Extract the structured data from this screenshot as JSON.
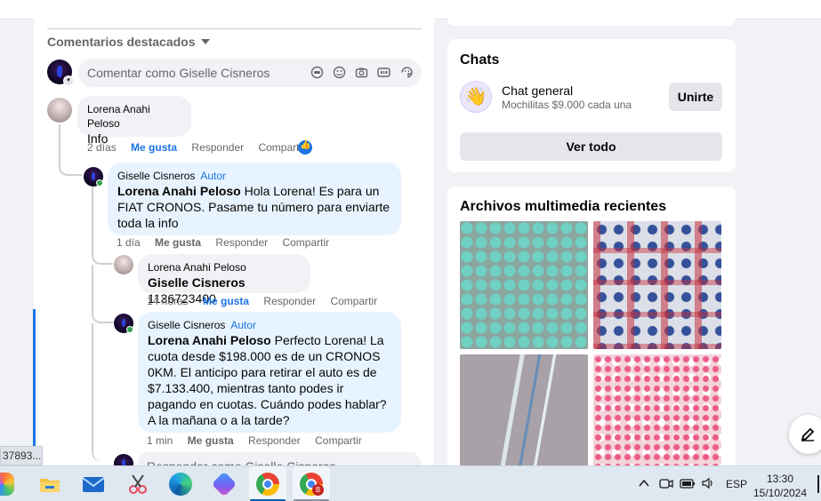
{
  "featured": {
    "label": "Comentarios destacados"
  },
  "composer": {
    "placeholder": "Comentar como Giselle Cisneros"
  },
  "comments": [
    {
      "author": "Lorena Anahi Peloso",
      "text": "Info",
      "time": "2 días",
      "like": "Me gusta",
      "reply": "Responder",
      "share": "Compartir"
    },
    {
      "author": "Giselle Cisneros",
      "role": "Autor",
      "mention": "Lorena Anahi Peloso",
      "text": " Hola Lorena! Es para un FIAT CRONOS. Pasame tu número para enviarte toda la info",
      "time": "1 día",
      "like": "Me gusta",
      "reply": "Responder",
      "share": "Compartir"
    },
    {
      "author": "Lorena Anahi Peloso",
      "mention": "Giselle Cisneros",
      "text": " 1136723400",
      "time": "14 horas",
      "like": "Me gusta",
      "reply": "Responder",
      "share": "Compartir"
    },
    {
      "author": "Giselle Cisneros",
      "role": "Autor",
      "mention": "Lorena Anahi Peloso",
      "text": " Perfecto Lorena! La cuota desde $198.000 es de un CRONOS 0KM. El anticipo para retirar el auto es de $7.133.400, mientras tanto podes ir pagando en cuotas. Cuándo podes hablar? A la mañana o a la tarde?",
      "time": "1 min",
      "like": "Me gusta",
      "reply": "Responder",
      "share": "Compartir"
    }
  ],
  "reply_input": {
    "placeholder": "Responder como Giselle Cisneros"
  },
  "tooltip": {
    "text": "37893..."
  },
  "chats": {
    "title": "Chats",
    "item": {
      "name": "Chat general",
      "subtitle": "Mochilitas $9.000 cada una",
      "emoji": "👋"
    },
    "join": "Unirte",
    "see_all": "Ver todo"
  },
  "media": {
    "title": "Archivos multimedia recientes"
  },
  "taskbar": {
    "apps": [
      "copilot-icon",
      "file-explorer-icon",
      "mail-icon",
      "snipping-tool-icon",
      "edge-icon",
      "copilot-app-icon",
      "chrome-icon",
      "chrome-profile-icon"
    ],
    "profile_badge": "B",
    "lang": "ESP",
    "time": "13:30",
    "date": "15/10/2024"
  },
  "colors": {
    "accent": "#1b74e4",
    "online": "#31a24c",
    "bubble": "#f0f2f5"
  }
}
